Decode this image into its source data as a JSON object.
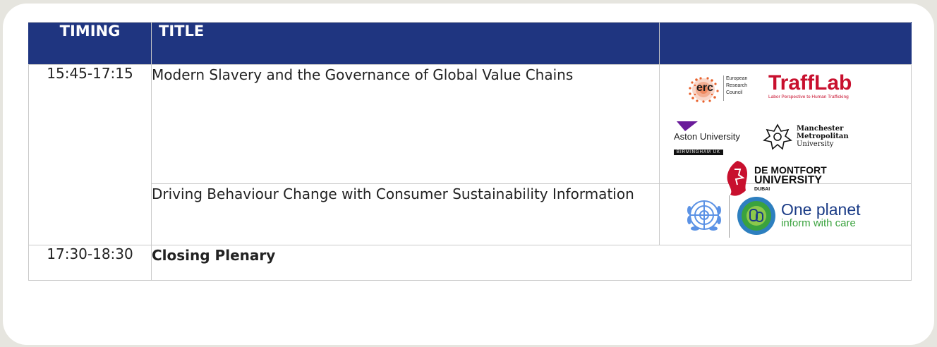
{
  "header": {
    "timing": "TIMING",
    "title": "TITLE",
    "logos": ""
  },
  "rows": [
    {
      "time": "15:45-17:15",
      "sessions": [
        {
          "title": "Modern Slavery and the Governance of Global Value Chains",
          "logos": {
            "erc": {
              "word": "erc",
              "line1": "European",
              "line2": "Research",
              "line3": "Council"
            },
            "trafflab": {
              "word": "TraffLab",
              "tagline": "Labor Perspective to Human Trafficking"
            },
            "aston": {
              "name": "Aston University",
              "location": "BIRMINGHAM UK"
            },
            "mmu": {
              "line1": "Manchester",
              "line2": "Metropolitan",
              "line3": "University"
            },
            "dmu": {
              "line1": "DE MONTFORT",
              "line2": "UNIVERSITY",
              "line3": "DUBAI"
            }
          }
        },
        {
          "title": "Driving Behaviour Change with Consumer Sustainability Information",
          "logos": {
            "oneplanet": {
              "line1": "One planet",
              "line2": "inform with care"
            }
          }
        }
      ]
    },
    {
      "time": "17:30-18:30",
      "sessions": [
        {
          "title": "Closing Plenary"
        }
      ]
    }
  ],
  "colors": {
    "header_bg": "#1f3580",
    "page_bg": "#e6e5df",
    "erc_orange": "#e8612c",
    "trafflab_red": "#c8102e",
    "aston_purple": "#6a1b9a",
    "dmu_red": "#c8102e",
    "oneplanet_blue": "#1a3b86",
    "oneplanet_green": "#3aa23e",
    "un_blue": "#5b92e5"
  }
}
